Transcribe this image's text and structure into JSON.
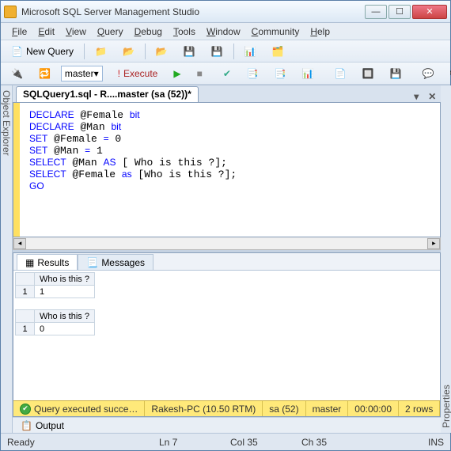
{
  "title": "Microsoft SQL Server Management Studio",
  "menu": {
    "file": "File",
    "edit": "Edit",
    "view": "View",
    "query": "Query",
    "debug": "Debug",
    "tools": "Tools",
    "window": "Window",
    "community": "Community",
    "help": "Help"
  },
  "toolbar": {
    "newquery": "New Query"
  },
  "db": {
    "selected": "master",
    "execute": "Execute"
  },
  "left_panel": "Object Explorer",
  "right_panel": "Properties",
  "doc": {
    "tab": "SQLQuery1.sql - R....master (sa (52))*"
  },
  "code_lines": [
    {
      "pre": "",
      "p1": "DECLARE",
      "mid": " @Female ",
      "p2": "bit",
      "post": ""
    },
    {
      "pre": "",
      "p1": "DECLARE",
      "mid": " @Man ",
      "p2": "bit",
      "post": ""
    },
    {
      "pre": "",
      "p1": "SET",
      "mid": " @Female ",
      "p2": "=",
      "post": " 0"
    },
    {
      "pre": "",
      "p1": "SET",
      "mid": " @Man ",
      "p2": "=",
      "post": " 1"
    },
    {
      "pre": "",
      "p1": "SELECT",
      "mid": " @Man ",
      "p2": "AS",
      "post": " [ Who is this ?];"
    },
    {
      "pre": "",
      "p1": "SELECT",
      "mid": " @Female ",
      "p2": "as",
      "post": " [Who is this ?];"
    },
    {
      "pre": "",
      "p1": "GO",
      "mid": "",
      "p2": "",
      "post": ""
    }
  ],
  "results": {
    "tab_results": "Results",
    "tab_messages": "Messages",
    "grids": [
      {
        "col": "Who is this ?",
        "row": "1",
        "val": "1"
      },
      {
        "col": "Who is this ?",
        "row": "1",
        "val": "0"
      }
    ]
  },
  "status_yellow": {
    "msg": "Query executed succe…",
    "server": "Rakesh-PC (10.50 RTM)",
    "user": "sa (52)",
    "db": "master",
    "time": "00:00:00",
    "rows": "2 rows"
  },
  "output_tab": "Output",
  "statusbar": {
    "ready": "Ready",
    "ln": "Ln 7",
    "col": "Col 35",
    "ch": "Ch 35",
    "ins": "INS"
  }
}
